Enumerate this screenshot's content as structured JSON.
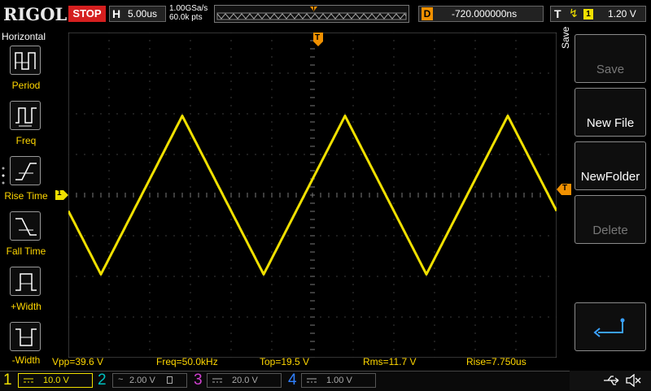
{
  "header": {
    "logo": "RIGOL",
    "run_status": "STOP",
    "horizontal_letter": "H",
    "timebase": "5.00us",
    "sample_rate": "1.00GSa/s",
    "memory_depth": "60.0k pts",
    "delay_letter": "D",
    "delay": "-720.000000ns",
    "trigger_letter": "T",
    "trigger_edge": "rising-edge-icon",
    "trigger_source": "1",
    "trigger_level": "1.20 V",
    "trigger_marker": "T"
  },
  "left_menu": {
    "title": "Horizontal",
    "items": [
      {
        "label": "Period",
        "icon": "period-icon"
      },
      {
        "label": "Freq",
        "icon": "freq-icon"
      },
      {
        "label": "Rise Time",
        "icon": "rise-time-icon"
      },
      {
        "label": "Fall Time",
        "icon": "fall-time-icon"
      },
      {
        "label": "+Width",
        "icon": "positive-width-icon"
      },
      {
        "label": "-Width",
        "icon": "negative-width-icon"
      }
    ]
  },
  "right_menu": {
    "title": "Save",
    "buttons": [
      {
        "label": "Save",
        "enabled": false
      },
      {
        "label": "New File",
        "enabled": true
      },
      {
        "label": "NewFolder",
        "enabled": true
      },
      {
        "label": "Delete",
        "enabled": false
      },
      {
        "label": "",
        "icon": "return-arrow-icon",
        "enabled": true
      }
    ]
  },
  "channel1_marker": "1",
  "measurements": {
    "vpp": "Vpp=39.6 V",
    "freq": "Freq=50.0kHz",
    "top": "Top=19.5 V",
    "rms": "Rms=11.7 V",
    "rise": "Rise=7.750us"
  },
  "channels": [
    {
      "number": "1",
      "scale": "10.0 V",
      "coupling": "dc-coupling-icon",
      "color": "#f0e000",
      "active": true
    },
    {
      "number": "2",
      "scale": "2.00 V",
      "coupling": "ac-coupling-icon",
      "color": "#00c0c0",
      "active": false
    },
    {
      "number": "3",
      "scale": "20.0 V",
      "coupling": "dc-coupling-icon",
      "color": "#d040d0",
      "active": false
    },
    {
      "number": "4",
      "scale": "1.00 V",
      "coupling": "dc-coupling-icon",
      "color": "#3080ff",
      "active": false
    }
  ],
  "status_icons": [
    "usb-icon",
    "speaker-muted-icon"
  ],
  "waveform": {
    "shape": "triangle",
    "color": "#f0e000",
    "volts_per_div": 10,
    "time_per_div_us": 5,
    "peak_v": 19.5,
    "trough_v": -19.5,
    "period_us": 20,
    "first_peak_time_us": -16
  }
}
